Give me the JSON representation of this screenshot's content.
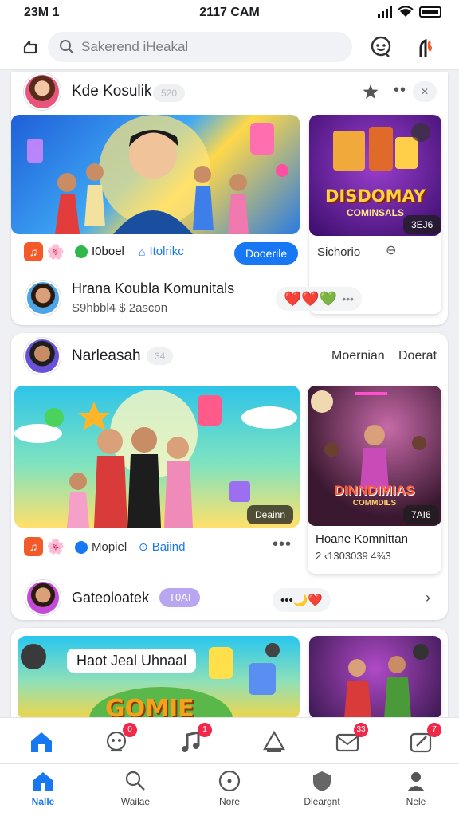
{
  "status_bar": {
    "left": "23M 1",
    "time": "2117 CAM"
  },
  "search": {
    "placeholder": "Sakerend iHeakal"
  },
  "post1": {
    "name": "Kde Kosulik",
    "pill": "520",
    "side_title_1": "DISDOMAY",
    "side_title_2": "COMINSALS",
    "side_badge": "3EJ6",
    "tag_1": "I0boel",
    "tag_2": "Itolrikc",
    "button": "Dooerile",
    "side_caption": "Sichorio",
    "comment_title": "Hrana Koubla Komunitals",
    "comment_sub": "S9hbbl4 $ 2ascon",
    "reactions": "❤️❤️💚"
  },
  "post2": {
    "name": "Narleasah",
    "pill": "34",
    "right_1": "Moernian",
    "right_2": "Doerat",
    "video_badge": "Deainn",
    "side_title_1": "DINNDIMIAS",
    "side_title_2": "COMMDILS",
    "side_badge": "7AI6",
    "tag_1": "Mopiel",
    "tag_2": "Baiind",
    "side_caption": "Hoane Komnittan",
    "side_sub": "2 ‹1303039 4¾3",
    "footer_name": "Gateoloatek",
    "footer_pill": "T0AI",
    "footer_reacts": "•••🌙❤️"
  },
  "post3": {
    "title": "Haot Jeal Uhnaal",
    "game_text": "GOMIE"
  },
  "mid_tabs": [
    {
      "name": "home",
      "badge": ""
    },
    {
      "name": "groups",
      "badge": "0"
    },
    {
      "name": "music",
      "badge": "1"
    },
    {
      "name": "events",
      "badge": ""
    },
    {
      "name": "messages",
      "badge": "33"
    },
    {
      "name": "notes",
      "badge": "7"
    }
  ],
  "bottom_nav": [
    {
      "label": "Nalle",
      "active": true
    },
    {
      "label": "Wailae",
      "active": false
    },
    {
      "label": "Nore",
      "active": false
    },
    {
      "label": "Dleargnt",
      "active": false
    },
    {
      "label": "Nele",
      "active": false
    }
  ],
  "colors": {
    "accent": "#1877f2",
    "notification": "#f02849"
  }
}
